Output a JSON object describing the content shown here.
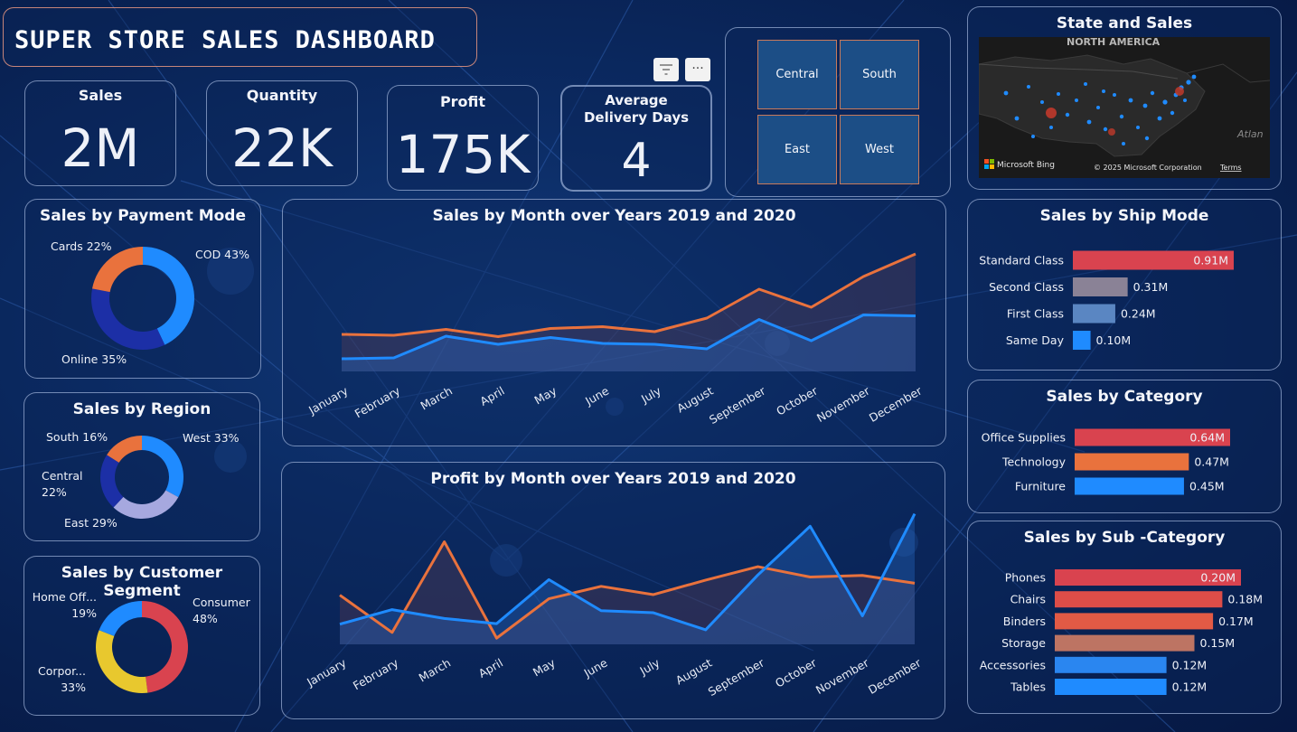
{
  "header": {
    "title": "SUPER STORE SALES DASHBOARD"
  },
  "kpis": {
    "sales": {
      "label": "Sales",
      "value": "2M"
    },
    "quantity": {
      "label": "Quantity",
      "value": "22K"
    },
    "profit": {
      "label": "Profit",
      "value": "175K"
    },
    "delivery": {
      "label": "Average Delivery Days",
      "value": "4"
    }
  },
  "toolbar": {
    "filter_icon": "filter-icon",
    "more_icon": "more-options-icon"
  },
  "region_slicer": [
    "Central",
    "South",
    "East",
    "West"
  ],
  "map": {
    "title": "State and Sales",
    "region_label": "NORTH AMERICA",
    "ocean_label": "Atlan",
    "brand": "Microsoft Bing",
    "copyright": "© 2025 Microsoft Corporation",
    "terms": "Terms"
  },
  "colors": {
    "blue": "#1f8bff",
    "orange": "#e9723d",
    "navy": "#1c2fa6",
    "lavender": "#a6a8df",
    "red": "#d9434f",
    "yellow": "#e8c82e"
  },
  "chart_data": [
    {
      "id": "payment",
      "type": "pie",
      "title": "Sales by Payment Mode",
      "slices": [
        {
          "label": "COD 43%",
          "value": 43,
          "color": "#1f8bff"
        },
        {
          "label": "Online 35%",
          "value": 35,
          "color": "#1c2fa6"
        },
        {
          "label": "Cards 22%",
          "value": 22,
          "color": "#e9723d"
        }
      ]
    },
    {
      "id": "region",
      "type": "pie",
      "title": "Sales by Region",
      "slices": [
        {
          "label": "West 33%",
          "value": 33,
          "color": "#1f8bff"
        },
        {
          "label": "East 29%",
          "value": 29,
          "color": "#a6a8df"
        },
        {
          "label": "Central 22%",
          "value": 22,
          "color": "#1c2fa6"
        },
        {
          "label": "South 16%",
          "value": 16,
          "color": "#e9723d"
        }
      ]
    },
    {
      "id": "segment",
      "type": "pie",
      "title": "Sales by Customer Segment",
      "slices": [
        {
          "label": "Consumer 48%",
          "value": 48,
          "color": "#d9434f"
        },
        {
          "label": "Corpor... 33%",
          "value": 33,
          "color": "#e8c82e"
        },
        {
          "label": "Home Off... 19%",
          "value": 19,
          "color": "#1f8bff"
        }
      ]
    },
    {
      "id": "sales_month",
      "type": "area",
      "title": "Sales by Month over Years 2019 and 2020",
      "categories": [
        "January",
        "February",
        "March",
        "April",
        "May",
        "June",
        "July",
        "August",
        "September",
        "October",
        "November",
        "December"
      ],
      "series": [
        {
          "values": [
            82,
            80,
            93,
            77,
            95,
            99,
            88,
            118,
            182,
            142,
            210,
            260
          ],
          "color": "#e9723d"
        },
        {
          "values": [
            28,
            30,
            78,
            60,
            75,
            62,
            60,
            50,
            115,
            68,
            125,
            123
          ],
          "color": "#1f8bff"
        }
      ],
      "ylim": [
        0,
        300
      ]
    },
    {
      "id": "profit_month",
      "type": "area",
      "title": "Profit by Month over Years 2019 and 2020",
      "categories": [
        "January",
        "February",
        "March",
        "April",
        "May",
        "June",
        "July",
        "August",
        "September",
        "October",
        "November",
        "December"
      ],
      "series": [
        {
          "values": [
            9.5,
            2.3,
            19.8,
            1.2,
            8.8,
            11.2,
            9.6,
            12.4,
            15.0,
            13.0,
            13.3,
            11.8
          ],
          "color": "#e9723d"
        },
        {
          "values": [
            3.9,
            6.7,
            5.0,
            4.0,
            12.5,
            6.5,
            6.1,
            2.8,
            13.4,
            22.8,
            5.5,
            25.2
          ],
          "color": "#1f8bff"
        }
      ],
      "ylim": [
        0,
        26
      ]
    },
    {
      "id": "shipmode",
      "type": "bar",
      "title": "Sales by Ship Mode",
      "categories": [
        "Standard Class",
        "Second Class",
        "First Class",
        "Same Day"
      ],
      "values": [
        0.91,
        0.31,
        0.24,
        0.1
      ],
      "labels": [
        "0.91M",
        "0.31M",
        "0.24M",
        "0.10M"
      ],
      "colors": [
        "#d9434f",
        "#8a8296",
        "#5a86c2",
        "#1f8bff"
      ]
    },
    {
      "id": "category",
      "type": "bar",
      "title": "Sales by Category",
      "categories": [
        "Office Supplies",
        "Technology",
        "Furniture"
      ],
      "values": [
        0.64,
        0.47,
        0.45
      ],
      "labels": [
        "0.64M",
        "0.47M",
        "0.45M"
      ],
      "colors": [
        "#d9434f",
        "#e9723d",
        "#1f8bff"
      ]
    },
    {
      "id": "subcategory",
      "type": "bar",
      "title": "Sales by Sub -Category",
      "categories": [
        "Phones",
        "Chairs",
        "Binders",
        "Storage",
        "Accessories",
        "Tables"
      ],
      "values": [
        0.2,
        0.18,
        0.17,
        0.15,
        0.12,
        0.12
      ],
      "labels": [
        "0.20M",
        "0.18M",
        "0.17M",
        "0.15M",
        "0.12M",
        "0.12M"
      ],
      "colors": [
        "#d9434f",
        "#dd4d48",
        "#e25a45",
        "#bd7463",
        "#2a86f0",
        "#1f8bff"
      ]
    }
  ]
}
